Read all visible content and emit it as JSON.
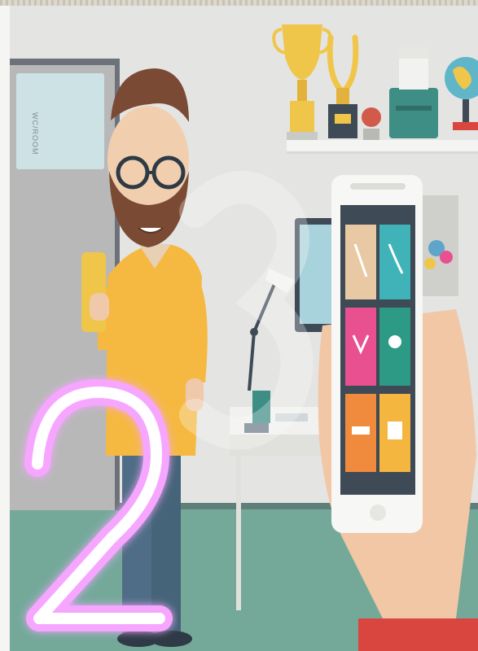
{
  "scene": {
    "door_sign_text": "WC/ROOM",
    "overlay_digit": "2"
  },
  "colors": {
    "wall": "#e4e4e2",
    "floor": "#74a99a",
    "shirt": "#f5b942",
    "neon": "#f6a6ff",
    "tile_pink": "#e9508f",
    "tile_teal": "#3fb3b8",
    "tile_orange": "#f08a3c",
    "tile_yellow": "#f4b63e"
  }
}
